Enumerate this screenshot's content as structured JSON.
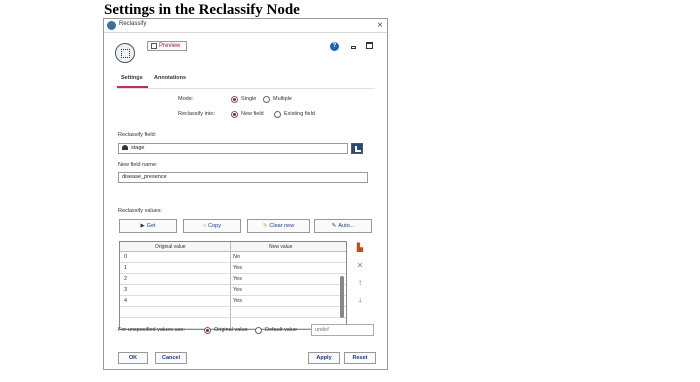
{
  "heading": "Settings in the Reclassify Node",
  "window": {
    "title": "Reclassify",
    "close": "×"
  },
  "toolbar": {
    "preview_label": "Preview",
    "help": "?"
  },
  "tabs": [
    {
      "label": "Settings",
      "active": true
    },
    {
      "label": "Annotations",
      "active": false
    }
  ],
  "mode": {
    "label": "Mode:",
    "options": [
      "Single",
      "Multiple"
    ],
    "selected": "Single"
  },
  "reclassify_into": {
    "label": "Reclassify into:",
    "options": [
      "New field",
      "Existing field"
    ],
    "selected": "New field"
  },
  "reclassify_field": {
    "label": "Reclassify field:",
    "value": "stage"
  },
  "new_field_name": {
    "label": "New field name:",
    "value": "disease_presence"
  },
  "values_section": {
    "label": "Reclassify values:",
    "buttons": {
      "get": "Get",
      "copy": "Copy",
      "clear_new": "Clear new",
      "auto": "Auto..."
    }
  },
  "table": {
    "columns": [
      "Original value",
      "New value"
    ],
    "rows": [
      {
        "original": "0",
        "new": "No"
      },
      {
        "original": "1",
        "new": "Yes"
      },
      {
        "original": "2",
        "new": "Yes"
      },
      {
        "original": "3",
        "new": "Yes"
      },
      {
        "original": "4",
        "new": "Yes"
      }
    ]
  },
  "side_icons": [
    "bar-chart-icon",
    "delete-x-icon",
    "move-up-icon",
    "move-down-icon"
  ],
  "unspecified": {
    "label": "For unspecified values use:",
    "options": [
      "Original value",
      "Default value"
    ],
    "selected": "Original value",
    "default_placeholder": "undef"
  },
  "footer": {
    "ok": "OK",
    "cancel": "Cancel",
    "apply": "Apply",
    "reset": "Reset"
  },
  "colors": {
    "accent": "#c0304a",
    "link": "#1a3b8a",
    "radio_on": "#b01030"
  }
}
